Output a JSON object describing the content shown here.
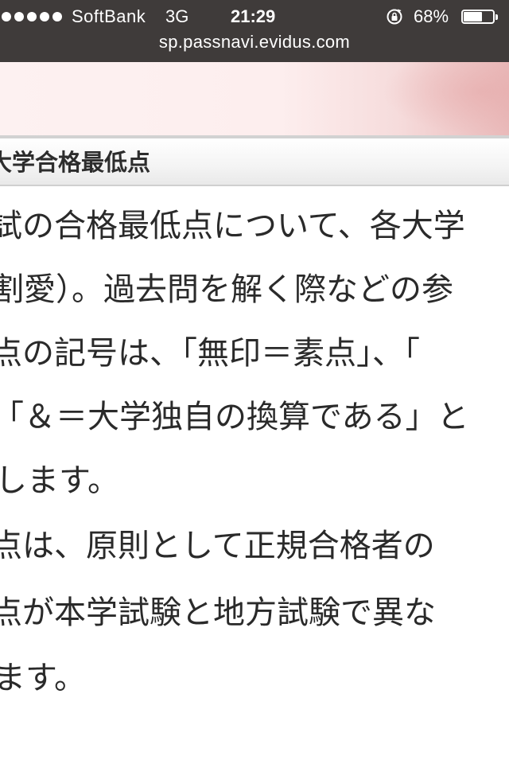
{
  "status_bar": {
    "carrier": "SoftBank",
    "network": "3G",
    "time": "21:29",
    "battery_percent_label": "68%",
    "battery_level": 0.68,
    "url": "sp.passnavi.evidus.com"
  },
  "section": {
    "title": "大学合格最低点"
  },
  "content": {
    "lines": [
      "試の合格最低点について、各大学",
      "割愛）。過去問を解く際などの参",
      "点の記号は、「無印＝素点」、「",
      "「＆＝大学独自の換算である」と",
      "します。",
      "点は、原則として正規合格者の",
      "点が本学試験と地方試験で異な",
      "ます。"
    ]
  }
}
